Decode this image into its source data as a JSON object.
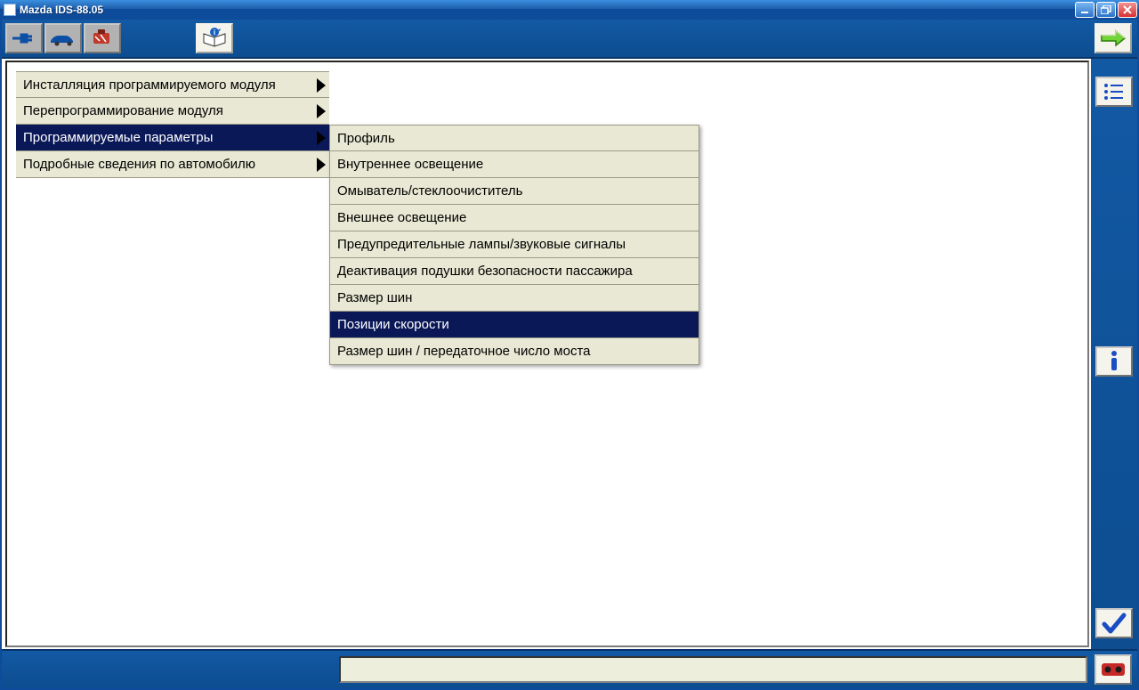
{
  "window": {
    "title": "Mazda IDS-88.05"
  },
  "menu1": {
    "items": [
      {
        "label": "Инсталляция программируемого модуля",
        "arrow": true,
        "selected": false
      },
      {
        "label": "Перепрограммирование модуля",
        "arrow": true,
        "selected": false
      },
      {
        "label": "Программируемые параметры",
        "arrow": true,
        "selected": true
      },
      {
        "label": "Подробные сведения по автомобилю",
        "arrow": true,
        "selected": false
      }
    ]
  },
  "menu2": {
    "items": [
      {
        "label": "Профиль",
        "selected": false
      },
      {
        "label": "Внутреннее освещение",
        "selected": false
      },
      {
        "label": "Омыватель/стеклоочиститель",
        "selected": false
      },
      {
        "label": "Внешнее освещение",
        "selected": false
      },
      {
        "label": "Предупредительные лампы/звуковые сигналы",
        "selected": false
      },
      {
        "label": "Деактивация подушки безопасности пассажира",
        "selected": false
      },
      {
        "label": "Размер шин",
        "selected": false
      },
      {
        "label": "Позиции скорости",
        "selected": true
      },
      {
        "label": "Размер шин / передаточное число моста",
        "selected": false
      }
    ]
  },
  "status": {
    "text": ""
  }
}
